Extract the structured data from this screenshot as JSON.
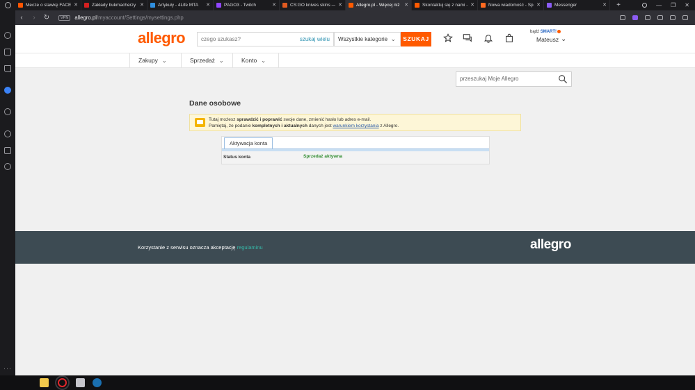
{
  "browser": {
    "tabs": [
      {
        "title": "Mecze o stawkę FACEIT",
        "favicon_color": "#ff5500"
      },
      {
        "title": "Zakłady bukmacherzy ľ",
        "favicon_color": "#d42020"
      },
      {
        "title": "Artykuły - 4Life MTA",
        "favicon_color": "#2f8fe0"
      },
      {
        "title": "PAGO3 - Twitch",
        "favicon_color": "#9146ff"
      },
      {
        "title": "CS:GO knives skins — Tr",
        "favicon_color": "#e05a20"
      },
      {
        "title": "Allegro.pl - Więcej niż",
        "favicon_color": "#ff5a00"
      },
      {
        "title": "Skontaktuj się z nami -",
        "favicon_color": "#ff5a00"
      },
      {
        "title": "Nowa wiadomość - Spo",
        "favicon_color": "#ff6a20"
      },
      {
        "title": "Messenger",
        "favicon_color": "#8b5cf6"
      }
    ],
    "active_tab_index": 5,
    "address": {
      "vpn_badge": "VPN",
      "domain": "allegro.pl",
      "path": "/myaccount/Settings/mysettings.php"
    }
  },
  "header": {
    "logo": "allegro",
    "search_placeholder": "czego szukasz?",
    "search_many_label": "szukaj wielu",
    "category_value": "Wszystkie kategorie",
    "search_button_label": "SZUKAJ",
    "smart_prefix": "bądź",
    "smart_label": "SMART!",
    "user_name": "Mateusz"
  },
  "subnav": {
    "items": [
      "Zakupy",
      "Sprzedaż",
      "Konto"
    ]
  },
  "myallegro_search_placeholder": "przeszukaj Moje Allegro",
  "page": {
    "title": "Dane osobowe",
    "info": {
      "line1_pre": "Tutaj możesz ",
      "line1_bold": "sprawdzić i poprawić",
      "line1_post": " swoje dane, zmienić hasło lub adres e-mail.",
      "line2_pre": "Pamiętaj, że podanie ",
      "line2_bold": "kompletnych i aktualnych",
      "line2_mid": " danych jest ",
      "line2_link": "warunkiem korzystania",
      "line2_post": " z Allegro."
    },
    "panel": {
      "tab_label": "Aktywacja konta",
      "status_label": "Status konta",
      "status_value": "Sprzedaż aktywna"
    }
  },
  "footer": {
    "text": "Korzystanie z serwisu oznacza akceptację ",
    "link": "regulaminu",
    "logo": "allegro"
  },
  "colors": {
    "brand": "#ff5a00",
    "footer_bg": "#3d4b53",
    "status_green": "#2e8b2e"
  }
}
